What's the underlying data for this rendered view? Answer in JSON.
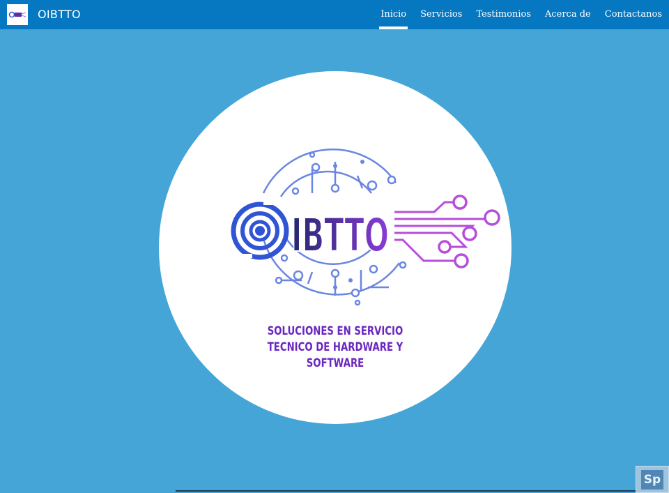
{
  "header": {
    "brand_name": "OIBTTO",
    "logo_icon": "oibtto-logo-icon",
    "nav": [
      {
        "label": "Inicio",
        "active": true
      },
      {
        "label": "Servicios",
        "active": false
      },
      {
        "label": "Testimonios",
        "active": false
      },
      {
        "label": "Acerca de",
        "active": false
      },
      {
        "label": "Contactanos",
        "active": false
      }
    ]
  },
  "hero": {
    "logo_text": "IBTTO",
    "tagline": [
      "SOLUCIONES EN SERVICIO",
      "TECNICO DE HARDWARE Y",
      "SOFTWARE"
    ]
  },
  "corner_badge": {
    "label": "Sp"
  },
  "colors": {
    "header_bg": "#0678c2",
    "page_bg": "#44a5d6",
    "logo_blue": "#2f55d4",
    "logo_purple": "#8b3bd8",
    "tagline": "#6a27c0"
  }
}
